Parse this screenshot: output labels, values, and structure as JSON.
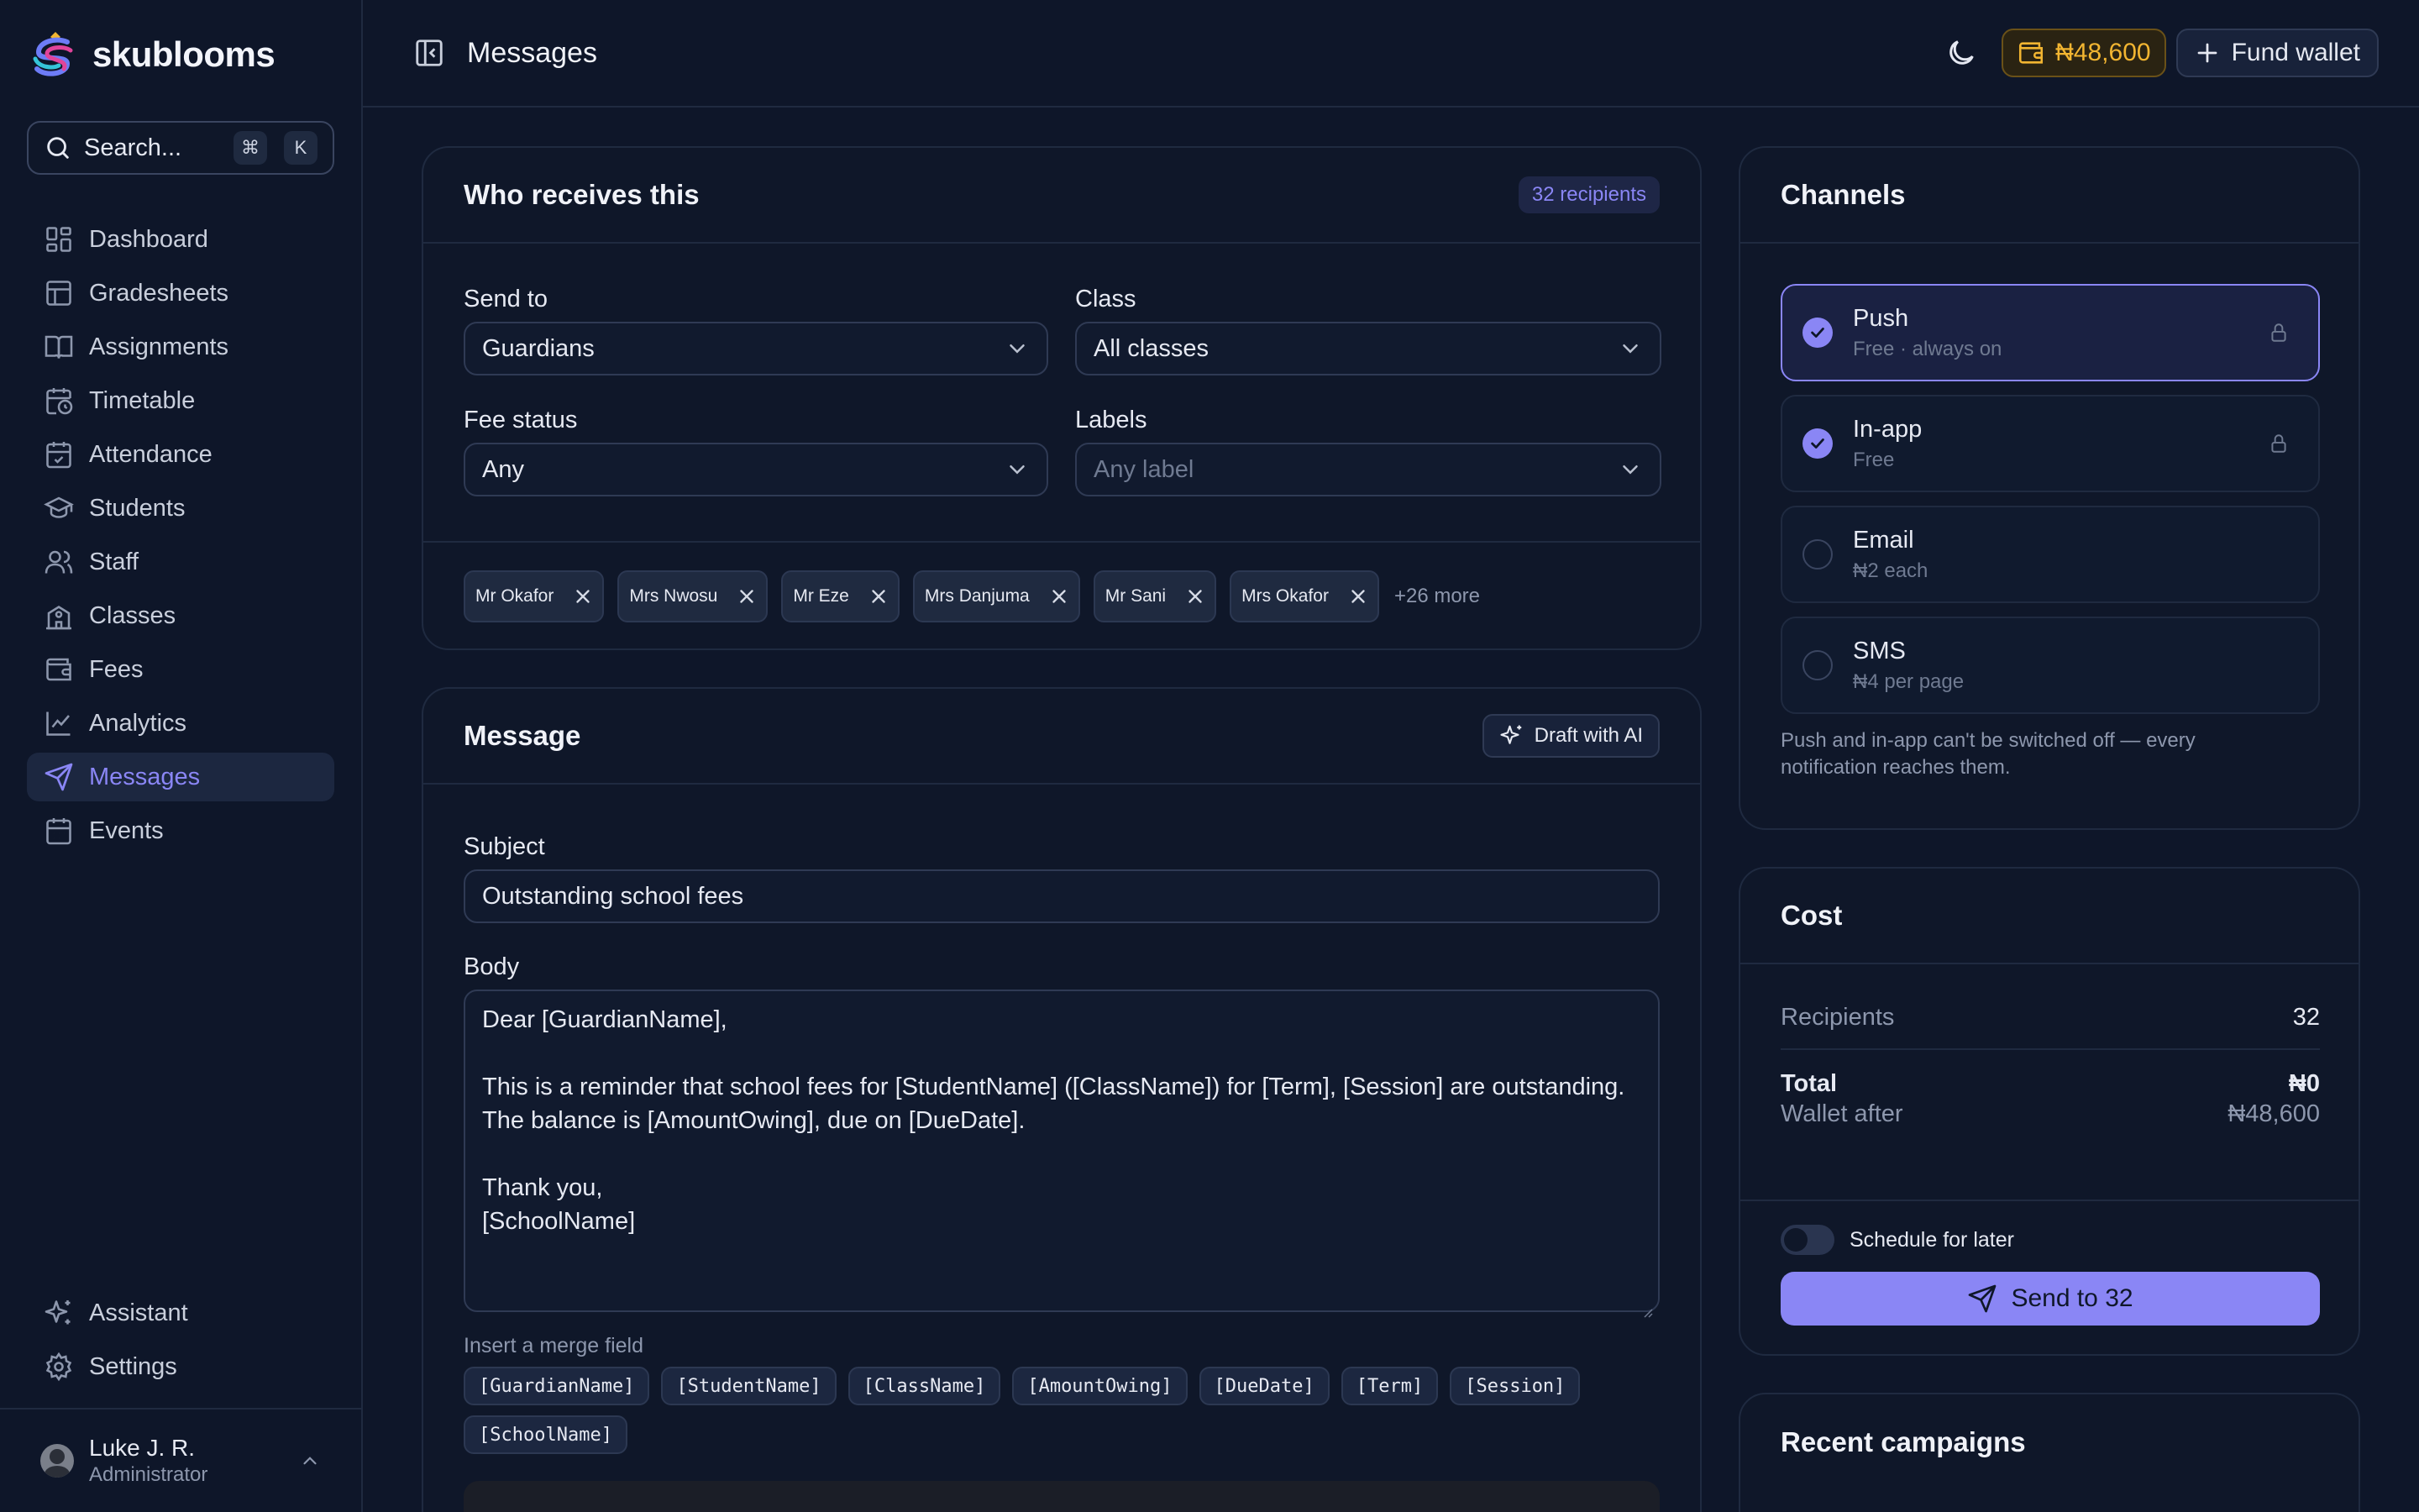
{
  "brand": {
    "name": "skublooms"
  },
  "search": {
    "label": "Search...",
    "kbd_cmd": "⌘",
    "kbd_key": "K"
  },
  "nav": [
    {
      "label": "Dashboard",
      "icon": "dashboard-icon"
    },
    {
      "label": "Gradesheets",
      "icon": "table-icon"
    },
    {
      "label": "Assignments",
      "icon": "book-icon"
    },
    {
      "label": "Timetable",
      "icon": "calendar-clock-icon"
    },
    {
      "label": "Attendance",
      "icon": "calendar-check-icon"
    },
    {
      "label": "Students",
      "icon": "graduation-cap-icon"
    },
    {
      "label": "Staff",
      "icon": "users-icon"
    },
    {
      "label": "Classes",
      "icon": "school-icon"
    },
    {
      "label": "Fees",
      "icon": "wallet-icon"
    },
    {
      "label": "Analytics",
      "icon": "chart-line-icon"
    },
    {
      "label": "Messages",
      "icon": "send-icon",
      "active": true
    },
    {
      "label": "Events",
      "icon": "calendar-icon"
    }
  ],
  "nav_bottom": [
    {
      "label": "Assistant",
      "icon": "sparkles-icon"
    },
    {
      "label": "Settings",
      "icon": "gear-icon"
    }
  ],
  "user": {
    "name": "Luke J. R.",
    "role": "Administrator"
  },
  "header": {
    "title": "Messages",
    "wallet_balance": "₦48,600",
    "fund_label": "Fund wallet"
  },
  "recipients_card": {
    "title": "Who receives this",
    "count": "32 recipients",
    "send_to": {
      "label": "Send to",
      "value": "Guardians"
    },
    "class": {
      "label": "Class",
      "value": "All classes"
    },
    "fee_status": {
      "label": "Fee status",
      "value": "Any"
    },
    "labels": {
      "label": "Labels",
      "placeholder": "Any label"
    },
    "chips": [
      "Mr Okafor",
      "Mrs Nwosu",
      "Mr Eze",
      "Mrs Danjuma",
      "Mr Sani",
      "Mrs Okafor"
    ],
    "more": "+26 more"
  },
  "message_card": {
    "title": "Message",
    "ai_label": "Draft with AI",
    "subject_label": "Subject",
    "subject_value": "Outstanding school fees",
    "body_label": "Body",
    "body_value": "Dear [GuardianName],\n\nThis is a reminder that school fees for [StudentName] ([ClassName]) for [Term], [Session] are outstanding.\nThe balance is [AmountOwing], due on [DueDate].\n\nThank you,\n[SchoolName]",
    "merge_label": "Insert a merge field",
    "merge_fields": [
      "[GuardianName]",
      "[StudentName]",
      "[ClassName]",
      "[AmountOwing]",
      "[DueDate]",
      "[Term]",
      "[Session]",
      "[SchoolName]"
    ]
  },
  "channels_card": {
    "title": "Channels",
    "channels": [
      {
        "name": "Push",
        "sub": "Free · always on",
        "checked": true,
        "locked": true,
        "selected": true
      },
      {
        "name": "In-app",
        "sub": "Free",
        "checked": true,
        "locked": true,
        "selected": false
      },
      {
        "name": "Email",
        "sub": "₦2 each",
        "checked": false,
        "locked": false,
        "selected": false
      },
      {
        "name": "SMS",
        "sub": "₦4 per page",
        "checked": false,
        "locked": false,
        "selected": false
      }
    ],
    "note": "Push and in-app can't be switched off — every notification reaches them."
  },
  "cost_card": {
    "title": "Cost",
    "recipients_label": "Recipients",
    "recipients_value": "32",
    "total_label": "Total",
    "total_value": "₦0",
    "wallet_after_label": "Wallet after",
    "wallet_after_value": "₦48,600",
    "schedule_label": "Schedule for later",
    "send_label": "Send to 32"
  },
  "recent_card": {
    "title": "Recent campaigns"
  },
  "colors": {
    "accent": "#8a86f5",
    "wallet": "#f2b531",
    "background": "#0e1629"
  }
}
